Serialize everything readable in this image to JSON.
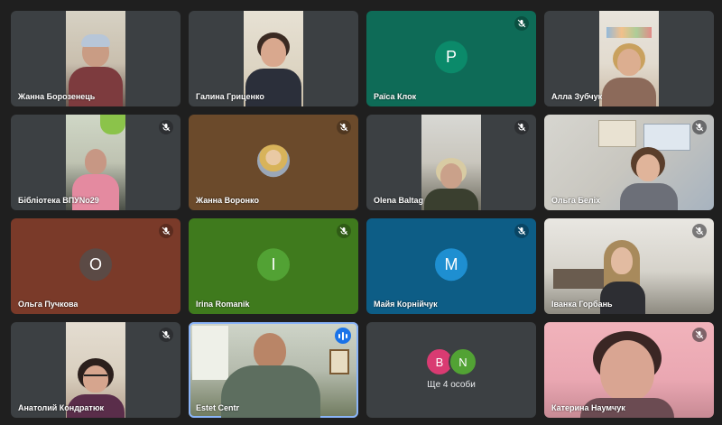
{
  "participants": [
    {
      "name": "Жанна Борозенець"
    },
    {
      "name": "Галина Гриценко"
    },
    {
      "name": "Раїса Клок",
      "initial": "P"
    },
    {
      "name": "Алла Зубчук"
    },
    {
      "name": "Бібліотека ВПУNo29"
    },
    {
      "name": "Жанна Воронко"
    },
    {
      "name": "Olena Baltag"
    },
    {
      "name": "Ольга Беліх"
    },
    {
      "name": "Ольга Пучкова",
      "initial": "O"
    },
    {
      "name": "Irina Romanik",
      "initial": "I"
    },
    {
      "name": "Майя Корнійчук",
      "initial": "M"
    },
    {
      "name": "Іванка Горбань"
    },
    {
      "name": "Анатолий Кондратюк"
    },
    {
      "name": "Estet Centr"
    },
    {
      "name": "Катерина Наумчук"
    }
  ],
  "more": {
    "label": "Ще 4 особи",
    "initials": [
      "В",
      "N"
    ]
  },
  "colors": {
    "background": "#1f1f1f",
    "tile": "#3c4043",
    "speaking_outline": "#8ab4f8",
    "raisa_tile": "#0e6b57",
    "raisa_avatar": "#0b8a6a",
    "voronko_tile": "#6b4a2b",
    "puchkova_tile": "#7a3a29",
    "romanik_tile": "#3f7a1d",
    "romanik_avatar": "#52a234",
    "korniichuk_tile": "#0d5d86",
    "korniichuk_avatar": "#1e8fd1",
    "more_b": "#d93b72",
    "more_n": "#52a234"
  }
}
